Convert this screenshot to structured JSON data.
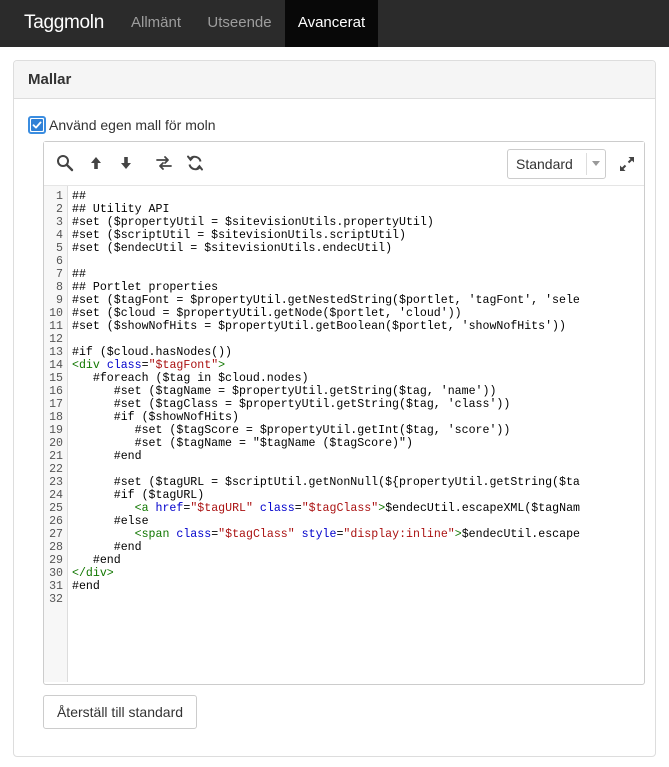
{
  "app": {
    "brand": "Taggmoln",
    "tabs": [
      {
        "label": "Allmänt",
        "active": false
      },
      {
        "label": "Utseende",
        "active": false
      },
      {
        "label": "Avancerat",
        "active": true
      }
    ]
  },
  "panel": {
    "title": "Mallar",
    "custom_template_checkbox": {
      "label": "Använd egen mall för moln",
      "checked": true
    },
    "editor": {
      "toolbar_icons": [
        "search-icon",
        "arrow-up-icon",
        "arrow-down-icon",
        "replace-icon",
        "refresh-icon",
        "fullscreen-icon"
      ],
      "theme_select": {
        "value": "Standard"
      },
      "lines": [
        [
          {
            "t": "##"
          }
        ],
        [
          {
            "t": "## Utility API"
          }
        ],
        [
          {
            "t": "#set ($propertyUtil = $sitevisionUtils.propertyUtil)"
          }
        ],
        [
          {
            "t": "#set ($scriptUtil = $sitevisionUtils.scriptUtil)"
          }
        ],
        [
          {
            "t": "#set ($endecUtil = $sitevisionUtils.endecUtil)"
          }
        ],
        [
          {
            "t": ""
          }
        ],
        [
          {
            "t": "##"
          }
        ],
        [
          {
            "t": "## Portlet properties"
          }
        ],
        [
          {
            "t": "#set ($tagFont = $propertyUtil.getNestedString($portlet, 'tagFont', 'sele"
          }
        ],
        [
          {
            "t": "#set ($cloud = $propertyUtil.getNode($portlet, 'cloud'))"
          }
        ],
        [
          {
            "t": "#set ($showNofHits = $propertyUtil.getBoolean($portlet, 'showNofHits'))"
          }
        ],
        [
          {
            "t": ""
          }
        ],
        [
          {
            "t": "#if ($cloud.hasNodes())"
          }
        ],
        [
          {
            "t": "<div",
            "c": "tag"
          },
          {
            "t": " "
          },
          {
            "t": "class",
            "c": "attr"
          },
          {
            "t": "="
          },
          {
            "t": "\"$tagFont\"",
            "c": "str"
          },
          {
            "t": ">",
            "c": "tag"
          }
        ],
        [
          {
            "t": "   #foreach ($tag in $cloud.nodes)"
          }
        ],
        [
          {
            "t": "      #set ($tagName = $propertyUtil.getString($tag, 'name'))"
          }
        ],
        [
          {
            "t": "      #set ($tagClass = $propertyUtil.getString($tag, 'class'))"
          }
        ],
        [
          {
            "t": "      #if ($showNofHits)"
          }
        ],
        [
          {
            "t": "         #set ($tagScore = $propertyUtil.getInt($tag, 'score'))"
          }
        ],
        [
          {
            "t": "         #set ($tagName = \"$tagName ($tagScore)\")"
          }
        ],
        [
          {
            "t": "      #end"
          }
        ],
        [
          {
            "t": ""
          }
        ],
        [
          {
            "t": "      #set ($tagURL = $scriptUtil.getNonNull(${propertyUtil.getString($ta"
          }
        ],
        [
          {
            "t": "      #if ($tagURL)"
          }
        ],
        [
          {
            "t": "         "
          },
          {
            "t": "<a",
            "c": "tag"
          },
          {
            "t": " "
          },
          {
            "t": "href",
            "c": "attr"
          },
          {
            "t": "="
          },
          {
            "t": "\"$tagURL\"",
            "c": "str"
          },
          {
            "t": " "
          },
          {
            "t": "class",
            "c": "attr"
          },
          {
            "t": "="
          },
          {
            "t": "\"$tagClass\"",
            "c": "str"
          },
          {
            "t": ">",
            "c": "tag"
          },
          {
            "t": "$endecUtil.escapeXML($tagNam"
          }
        ],
        [
          {
            "t": "      #else"
          }
        ],
        [
          {
            "t": "         "
          },
          {
            "t": "<span",
            "c": "tag"
          },
          {
            "t": " "
          },
          {
            "t": "class",
            "c": "attr"
          },
          {
            "t": "="
          },
          {
            "t": "\"$tagClass\"",
            "c": "str"
          },
          {
            "t": " "
          },
          {
            "t": "style",
            "c": "attr"
          },
          {
            "t": "="
          },
          {
            "t": "\"display:inline\"",
            "c": "str"
          },
          {
            "t": ">",
            "c": "tag"
          },
          {
            "t": "$endecUtil.escape"
          }
        ],
        [
          {
            "t": "      #end"
          }
        ],
        [
          {
            "t": "   #end"
          }
        ],
        [
          {
            "t": "</div>",
            "c": "tag"
          }
        ],
        [
          {
            "t": "#end"
          }
        ],
        [
          {
            "t": ""
          }
        ]
      ]
    },
    "reset_button": "Återställ till standard"
  },
  "colors": {
    "navbar_bg": "#2b2b2b",
    "active_tab_bg": "#080808",
    "checkbox_accent": "#2f80d6",
    "code_tag": "#117700",
    "code_attr": "#0000cc",
    "code_string": "#aa1111"
  }
}
